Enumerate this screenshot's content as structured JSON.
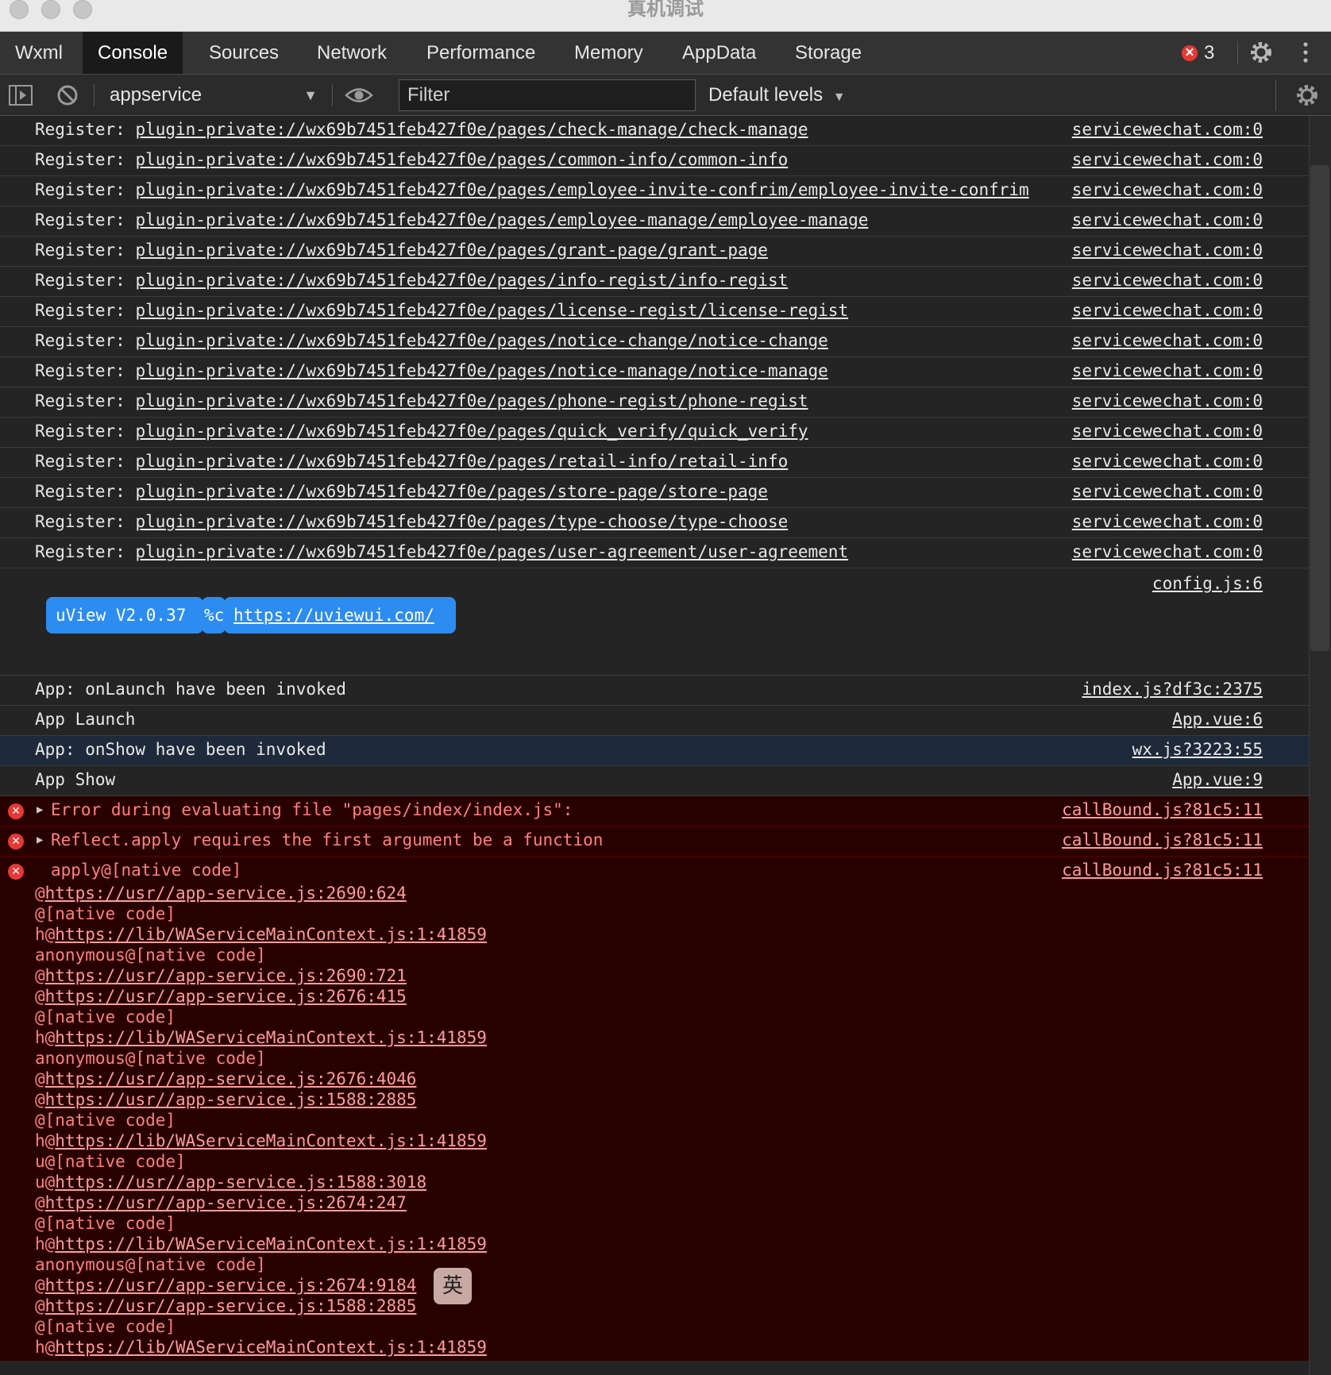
{
  "window": {
    "title": "真机调试"
  },
  "tabs": [
    "Wxml",
    "Console",
    "Sources",
    "Network",
    "Performance",
    "Memory",
    "AppData",
    "Storage"
  ],
  "active_tab": "Console",
  "header": {
    "error_count": "3"
  },
  "toolbar": {
    "context": "appservice",
    "filter_placeholder": "Filter",
    "levels": "Default levels"
  },
  "console": {
    "register_label": "Register: ",
    "register_rows": [
      {
        "path": "plugin-private://wx69b7451feb427f0e/pages/check-manage/check-manage",
        "source": "servicewechat.com:0"
      },
      {
        "path": "plugin-private://wx69b7451feb427f0e/pages/common-info/common-info",
        "source": "servicewechat.com:0"
      },
      {
        "path": "plugin-private://wx69b7451feb427f0e/pages/employee-invite-confrim/employee-invite-confrim",
        "source": "servicewechat.com:0"
      },
      {
        "path": "plugin-private://wx69b7451feb427f0e/pages/employee-manage/employee-manage",
        "source": "servicewechat.com:0"
      },
      {
        "path": "plugin-private://wx69b7451feb427f0e/pages/grant-page/grant-page",
        "source": "servicewechat.com:0"
      },
      {
        "path": "plugin-private://wx69b7451feb427f0e/pages/info-regist/info-regist",
        "source": "servicewechat.com:0"
      },
      {
        "path": "plugin-private://wx69b7451feb427f0e/pages/license-regist/license-regist",
        "source": "servicewechat.com:0"
      },
      {
        "path": "plugin-private://wx69b7451feb427f0e/pages/notice-change/notice-change",
        "source": "servicewechat.com:0"
      },
      {
        "path": "plugin-private://wx69b7451feb427f0e/pages/notice-manage/notice-manage",
        "source": "servicewechat.com:0"
      },
      {
        "path": "plugin-private://wx69b7451feb427f0e/pages/phone-regist/phone-regist",
        "source": "servicewechat.com:0"
      },
      {
        "path": "plugin-private://wx69b7451feb427f0e/pages/quick_verify/quick_verify",
        "source": "servicewechat.com:0"
      },
      {
        "path": "plugin-private://wx69b7451feb427f0e/pages/retail-info/retail-info",
        "source": "servicewechat.com:0"
      },
      {
        "path": "plugin-private://wx69b7451feb427f0e/pages/store-page/store-page",
        "source": "servicewechat.com:0"
      },
      {
        "path": "plugin-private://wx69b7451feb427f0e/pages/type-choose/type-choose",
        "source": "servicewechat.com:0"
      },
      {
        "path": "plugin-private://wx69b7451feb427f0e/pages/user-agreement/user-agreement",
        "source": "servicewechat.com:0"
      }
    ],
    "uview": {
      "source": "config.js:6",
      "version": "uView V2.0.37",
      "format": "%c",
      "link": "https://uviewui.com/"
    },
    "log_rows": [
      {
        "text": "App: onLaunch have been invoked",
        "source": "index.js?df3c:2375"
      },
      {
        "text": "App Launch",
        "source": "App.vue:6"
      },
      {
        "text": "App: onShow have been invoked",
        "source": "wx.js?3223:55"
      },
      {
        "text": "App Show",
        "source": "App.vue:9"
      }
    ],
    "errors": [
      {
        "text": "Error during evaluating file \"pages/index/index.js\":",
        "source": "callBound.js?81c5:11"
      },
      {
        "text": "Reflect.apply requires the first argument be a function",
        "source": "callBound.js?81c5:11"
      },
      {
        "text": "apply@[native code]",
        "source": "callBound.js?81c5:11"
      }
    ],
    "stack": [
      {
        "prefix": "@",
        "link": "https://usr//app-service.js:2690:624"
      },
      {
        "prefix": "@[native code]",
        "link": ""
      },
      {
        "prefix": "h@",
        "link": "https://lib/WAServiceMainContext.js:1:41859"
      },
      {
        "prefix": "anonymous@[native code]",
        "link": ""
      },
      {
        "prefix": "@",
        "link": "https://usr//app-service.js:2690:721"
      },
      {
        "prefix": "@",
        "link": "https://usr//app-service.js:2676:415"
      },
      {
        "prefix": "@[native code]",
        "link": ""
      },
      {
        "prefix": "h@",
        "link": "https://lib/WAServiceMainContext.js:1:41859"
      },
      {
        "prefix": "anonymous@[native code]",
        "link": ""
      },
      {
        "prefix": "@",
        "link": "https://usr//app-service.js:2676:4046"
      },
      {
        "prefix": "@",
        "link": "https://usr//app-service.js:1588:2885"
      },
      {
        "prefix": "@[native code]",
        "link": ""
      },
      {
        "prefix": "h@",
        "link": "https://lib/WAServiceMainContext.js:1:41859"
      },
      {
        "prefix": "u@[native code]",
        "link": ""
      },
      {
        "prefix": "u@",
        "link": "https://usr//app-service.js:1588:3018"
      },
      {
        "prefix": "@",
        "link": "https://usr//app-service.js:2674:247"
      },
      {
        "prefix": "@[native code]",
        "link": ""
      },
      {
        "prefix": "h@",
        "link": "https://lib/WAServiceMainContext.js:1:41859"
      },
      {
        "prefix": "anonymous@[native code]",
        "link": ""
      },
      {
        "prefix": "@",
        "link": "https://usr//app-service.js:2674:9184"
      },
      {
        "prefix": "@",
        "link": "https://usr//app-service.js:1588:2885"
      },
      {
        "prefix": "@[native code]",
        "link": ""
      },
      {
        "prefix": "h@",
        "link": "https://lib/WAServiceMainContext.js:1:41859"
      }
    ]
  },
  "ime": {
    "label": "英"
  },
  "icons": {
    "error": "✕",
    "expand": "▶",
    "dropdown": "▼"
  },
  "colors": {
    "error_bg": "#290000",
    "error_text": "#ff8080",
    "uview_blue": "#2d8cf0",
    "error_badge": "#e53935"
  }
}
